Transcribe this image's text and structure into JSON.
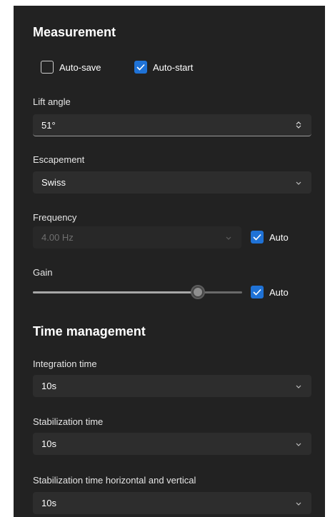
{
  "measurement": {
    "title": "Measurement",
    "auto_save": {
      "label": "Auto-save",
      "checked": false
    },
    "auto_start": {
      "label": "Auto-start",
      "checked": true
    },
    "lift_angle": {
      "label": "Lift angle",
      "value": "51°",
      "icon": "spin-updown-icon"
    },
    "escapement": {
      "label": "Escapement",
      "value": "Swiss",
      "icon": "chevron-down-icon"
    },
    "frequency": {
      "label": "Frequency",
      "value": "4.00 Hz",
      "disabled": true,
      "auto_label": "Auto",
      "auto_checked": true
    },
    "gain": {
      "label": "Gain",
      "level_fraction": 0.79,
      "auto_label": "Auto",
      "auto_checked": true
    }
  },
  "time_management": {
    "title": "Time management",
    "integration_time": {
      "label": "Integration time",
      "value": "10s"
    },
    "stabilization_time": {
      "label": "Stabilization time",
      "value": "10s"
    },
    "stabilization_hv": {
      "label": "Stabilization time horizontal and vertical",
      "value": "10s"
    }
  },
  "colors": {
    "panel_bg": "#222222",
    "field_bg": "#2d2d2d",
    "accent": "#1f72d6",
    "page_bg": "#ffffff"
  }
}
